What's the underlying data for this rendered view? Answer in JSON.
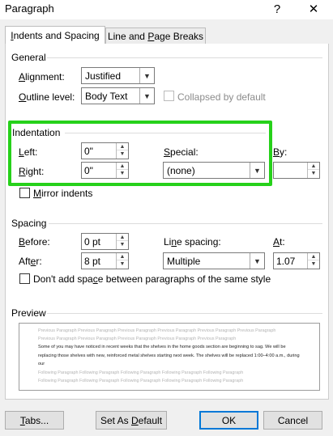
{
  "dialog": {
    "title": "Paragraph"
  },
  "window_controls": {
    "help": "?",
    "close": "✕"
  },
  "tabs": [
    {
      "label": "Indents and Spacing",
      "active": true
    },
    {
      "label": "Line and Page Breaks",
      "active": false
    }
  ],
  "general": {
    "title": "General",
    "alignment_label": "Alignment:",
    "alignment_value": "Justified",
    "outline_label": "Outline level:",
    "outline_value": "Body Text",
    "collapsed_label": "Collapsed by default"
  },
  "indentation": {
    "title": "Indentation",
    "left_label": "Left:",
    "left_value": "0\"",
    "right_label": "Right:",
    "right_value": "0\"",
    "special_label": "Special:",
    "special_value": "(none)",
    "by_label": "By:",
    "by_value": "",
    "mirror_label": "Mirror indents"
  },
  "spacing": {
    "title": "Spacing",
    "before_label": "Before:",
    "before_value": "0 pt",
    "after_label": "After:",
    "after_value": "8 pt",
    "line_spacing_label": "Line spacing:",
    "line_spacing_value": "Multiple",
    "at_label": "At:",
    "at_value": "1.07",
    "dont_add_label": "Don't add space between paragraphs of the same style"
  },
  "preview": {
    "title": "Preview",
    "previous_lines": [
      "Previous Paragraph Previous Paragraph Previous Paragraph Previous Paragraph Previous Paragraph Previous Paragraph",
      "Previous Paragraph Previous Paragraph Previous Paragraph Previous Paragraph Previous Paragraph"
    ],
    "sample_text": "Some of you may have noticed in recent weeks that the shelves in the home goods section are beginning to sag. We will be replacing those shelves with new, reinforced metal shelves starting next week. The shelves will be replaced 1:00–4:00 a.m., during our",
    "following_lines": [
      "Following Paragraph Following Paragraph Following Paragraph Following Paragraph Following Paragraph",
      "Following Paragraph Following Paragraph Following Paragraph Following Paragraph Following Paragraph"
    ]
  },
  "buttons": {
    "tabs": "Tabs...",
    "set_default": "Set As Default",
    "ok": "OK",
    "cancel": "Cancel"
  },
  "colors": {
    "highlight": "#26d11a",
    "default_button_border": "#0078d7"
  }
}
